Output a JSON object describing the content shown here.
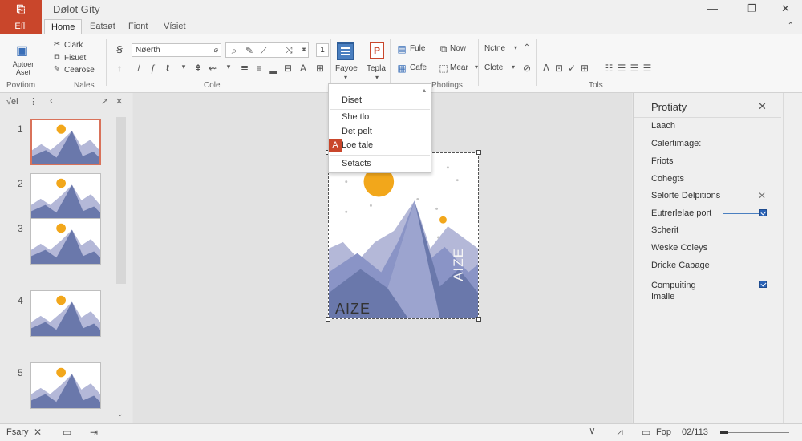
{
  "window": {
    "app_icon": "⎘",
    "title": "Dølot Gíty",
    "minimize": "—",
    "restore": "❐",
    "close": "✕"
  },
  "tabs": {
    "file": "Eíli",
    "items": [
      "Home",
      "Eatsøt",
      "Fiont",
      "Vísiet"
    ],
    "active_index": 0,
    "collapse": "⌃"
  },
  "ribbon": {
    "clipboard": {
      "big_button": "Aptoer\nAset",
      "items": [
        "Clark",
        "Fisuet",
        "Cearose"
      ],
      "label": "Povtiom"
    },
    "notes_label": "Nales",
    "font": {
      "name": "Nøerth",
      "size": "1",
      "label": "Cole"
    },
    "insert": {
      "button": "Fayoe",
      "ppt_badge": "P",
      "ppt_label": "Tepla"
    },
    "arrange": {
      "items": [
        "Fule",
        "Now",
        "Cafe",
        "Mear"
      ],
      "label": "Photings"
    },
    "editing": {
      "items": [
        "Nctne",
        "Clote"
      ],
      "label": "Tols"
    }
  },
  "thumbnails": {
    "header_icons": [
      "⇦",
      "⋮",
      "‹",
      "↗",
      "✕"
    ],
    "header_text": "√ei",
    "slides": [
      {
        "num": "1",
        "selected": true
      },
      {
        "num": "2",
        "selected": false
      },
      {
        "num": "3",
        "selected": false
      },
      {
        "num": "4",
        "selected": false
      },
      {
        "num": "5",
        "selected": false
      }
    ]
  },
  "slide": {
    "text_h": "AIZE",
    "text_v": "AIZE"
  },
  "dropdown": {
    "items": [
      "Diset",
      "Ѕhe tlo",
      "Det pelt",
      "Loe tale",
      "Setacts"
    ],
    "badge": "A",
    "caret": "▴"
  },
  "pane": {
    "title": "Protiaty",
    "close": "✕",
    "items": [
      {
        "label": "Laach"
      },
      {
        "label": "Calertimage:"
      },
      {
        "label": "Friots"
      },
      {
        "label": "Cohegts"
      },
      {
        "label": "Selorte Delpitions",
        "close": "✕"
      },
      {
        "label": "Eutrerlelae port",
        "checked": true
      },
      {
        "label": "Scherit"
      },
      {
        "label": "Weske Coleys"
      },
      {
        "label": "Dricke Cabage"
      },
      {
        "label": "Compuiting\nImalle",
        "checked": true
      }
    ]
  },
  "status": {
    "left_text": "Fsary",
    "left_x": "✕",
    "page": "02/113",
    "fit": "Fop",
    "zoom_percent": 12
  },
  "colors": {
    "accent": "#c9462b",
    "mountain_light": "#b4b8d8",
    "mountain_dark": "#6a78ab",
    "sun": "#f2a71b"
  }
}
